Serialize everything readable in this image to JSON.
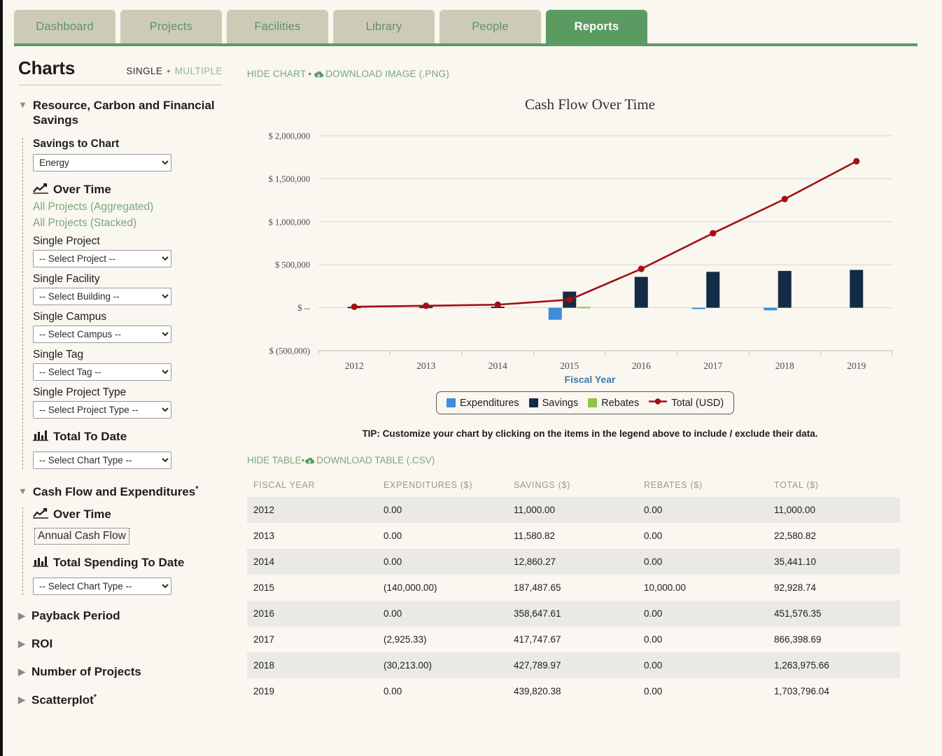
{
  "nav": {
    "tabs": [
      {
        "label": "Dashboard",
        "active": false
      },
      {
        "label": "Projects",
        "active": false
      },
      {
        "label": "Facilities",
        "active": false
      },
      {
        "label": "Library",
        "active": false
      },
      {
        "label": "People",
        "active": false
      },
      {
        "label": "Reports",
        "active": true
      }
    ]
  },
  "sidebar": {
    "title": "Charts",
    "mode_single": "SINGLE",
    "mode_dot": "•",
    "mode_multiple": "MULTIPLE",
    "group1": {
      "heading": "Resource, Carbon and Financial Savings",
      "savings_to_chart_label": "Savings to Chart",
      "savings_to_chart_value": "Energy",
      "over_time_label": "Over Time",
      "link_aggregated": "All Projects (Aggregated)",
      "link_stacked": "All Projects (Stacked)",
      "single_project_label": "Single Project",
      "single_project_value": "-- Select Project --",
      "single_facility_label": "Single Facility",
      "single_facility_value": "-- Select Building --",
      "single_campus_label": "Single Campus",
      "single_campus_value": "-- Select Campus --",
      "single_tag_label": "Single Tag",
      "single_tag_value": "-- Select Tag --",
      "single_project_type_label": "Single Project Type",
      "single_project_type_value": "-- Select Project Type --",
      "total_to_date_label": "Total To Date",
      "total_to_date_value": "-- Select Chart Type --"
    },
    "group2": {
      "heading": "Cash Flow and Expenditures",
      "heading_sup": "*",
      "over_time_label": "Over Time",
      "annual_cash_flow": "Annual Cash Flow",
      "total_spending_label": "Total Spending To Date",
      "total_spending_value": "-- Select Chart Type --"
    },
    "collapsed": [
      {
        "label": "Payback Period",
        "sup": ""
      },
      {
        "label": "ROI",
        "sup": ""
      },
      {
        "label": "Number of Projects",
        "sup": ""
      },
      {
        "label": "Scatterplot",
        "sup": "*"
      }
    ]
  },
  "main": {
    "hide_chart": "HIDE CHART",
    "download_image": "DOWNLOAD IMAGE (.PNG)",
    "hide_table": "HIDE TABLE",
    "download_table": "DOWNLOAD TABLE (.CSV)",
    "separator": "•",
    "tip": "TIP: Customize your chart by clicking on the items in the legend above to include / exclude their data."
  },
  "chart_data": {
    "type": "bar",
    "title": "Cash Flow Over Time",
    "xlabel": "Fiscal Year",
    "ylabel": "",
    "grid": true,
    "legend_position": "bottom",
    "categories": [
      "2012",
      "2013",
      "2014",
      "2015",
      "2016",
      "2017",
      "2018",
      "2019"
    ],
    "ytick_labels": [
      "$ 2,000,000",
      "$ 1,500,000",
      "$ 1,000,000",
      "$ 500,000",
      "$ --",
      "$ (500,000)"
    ],
    "ytick_values": [
      2000000,
      1500000,
      1000000,
      500000,
      0,
      -500000
    ],
    "ylim": [
      -500000,
      2000000
    ],
    "series": [
      {
        "name": "Expenditures",
        "color": "#3c8ddc",
        "type": "bar",
        "values": [
          0,
          0,
          0,
          -140000,
          0,
          -2925.33,
          -30213,
          0
        ]
      },
      {
        "name": "Savings",
        "color": "#132b45",
        "type": "bar",
        "values": [
          11000,
          11580.82,
          12860.27,
          187487.65,
          358647.61,
          417747.67,
          427789.97,
          439820.38
        ]
      },
      {
        "name": "Rebates",
        "color": "#8dc63f",
        "type": "bar",
        "values": [
          0,
          0,
          0,
          10000,
          0,
          0,
          0,
          0
        ]
      },
      {
        "name": "Total (USD)",
        "color": "#a10f14",
        "type": "line",
        "values": [
          11000,
          22580.82,
          35441.1,
          92928.74,
          451576.35,
          866398.69,
          1263975.66,
          1703796.04
        ]
      }
    ]
  },
  "table": {
    "columns": [
      "FISCAL YEAR",
      "EXPENDITURES ($)",
      "SAVINGS ($)",
      "REBATES ($)",
      "TOTAL ($)"
    ],
    "rows": [
      [
        "2012",
        "0.00",
        "11,000.00",
        "0.00",
        "11,000.00"
      ],
      [
        "2013",
        "0.00",
        "11,580.82",
        "0.00",
        "22,580.82"
      ],
      [
        "2014",
        "0.00",
        "12,860.27",
        "0.00",
        "35,441.10"
      ],
      [
        "2015",
        "(140,000.00)",
        "187,487.65",
        "10,000.00",
        "92,928.74"
      ],
      [
        "2016",
        "0.00",
        "358,647.61",
        "0.00",
        "451,576.35"
      ],
      [
        "2017",
        "(2,925.33)",
        "417,747.67",
        "0.00",
        "866,398.69"
      ],
      [
        "2018",
        "(30,213.00)",
        "427,789.97",
        "0.00",
        "1,263,975.66"
      ],
      [
        "2019",
        "0.00",
        "439,820.38",
        "0.00",
        "1,703,796.04"
      ]
    ]
  },
  "colors": {
    "brand_green": "#5b9b61",
    "tab_inactive": "#cdcbb7",
    "background": "#faf6f0",
    "expenditures": "#3c8ddc",
    "savings": "#132b45",
    "rebates": "#8dc63f",
    "total_line": "#a10f14",
    "axis_title": "#3f7aa8"
  }
}
